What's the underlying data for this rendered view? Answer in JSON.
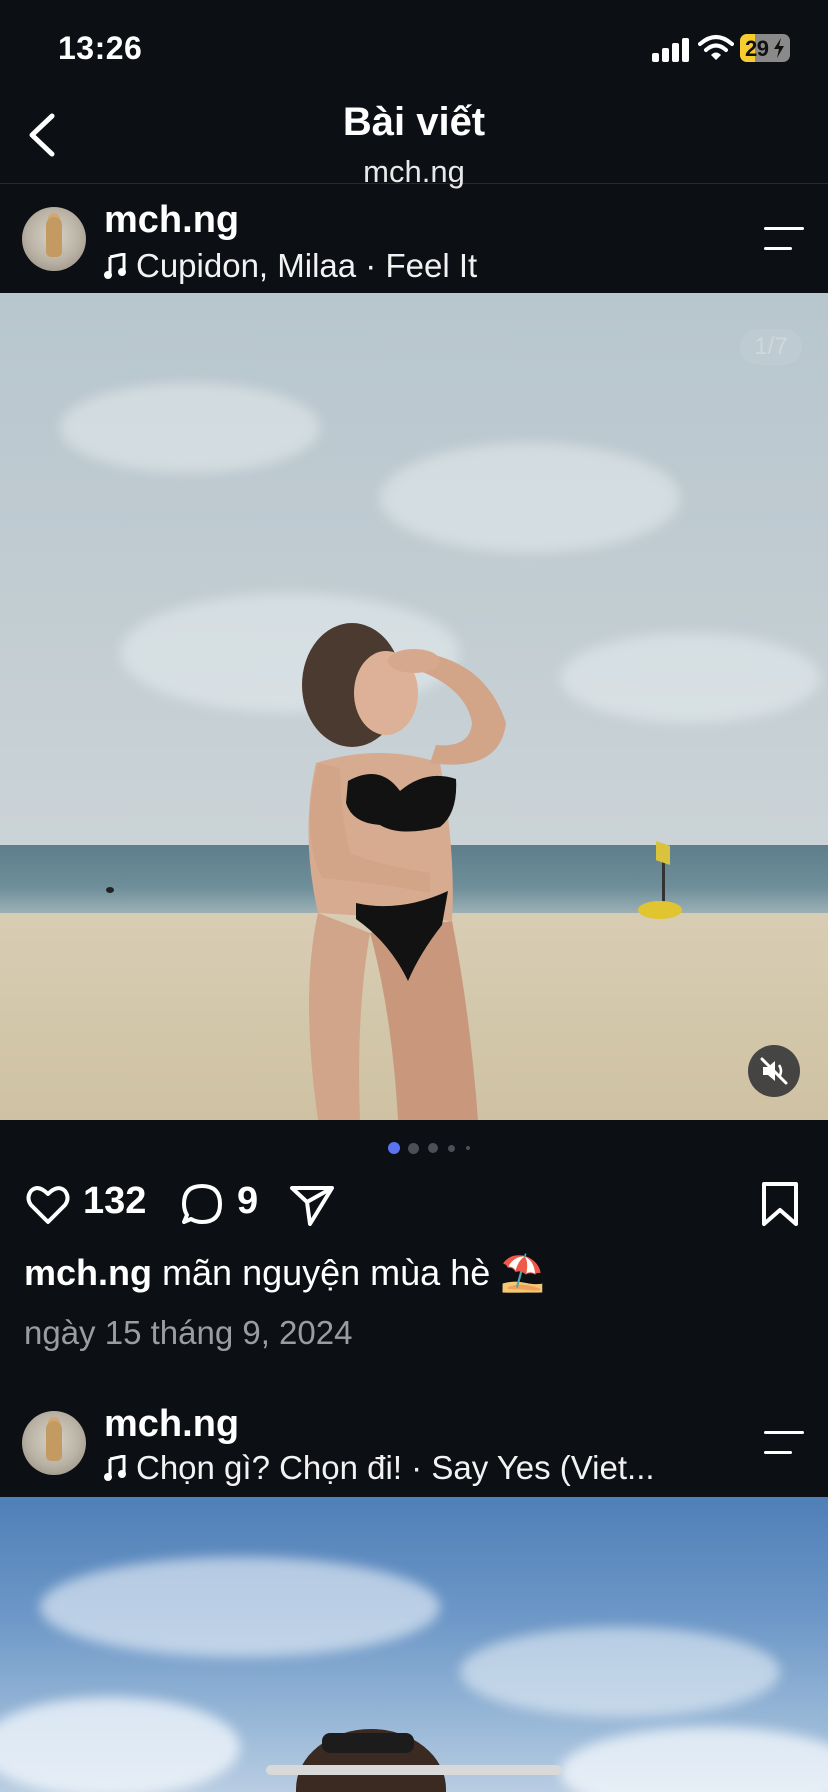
{
  "status_bar": {
    "time": "13:26",
    "battery_level": "29",
    "battery_fraction": 0.29,
    "battery_color": "#f7cc2e",
    "icons": [
      "signal-icon",
      "wifi-icon",
      "battery-icon",
      "charging-bolt-icon"
    ]
  },
  "header": {
    "title": "Bài viết",
    "subtitle": "mch.ng",
    "back_icon": "chevron-left-icon"
  },
  "posts": [
    {
      "username": "mch.ng",
      "music": "Cupidon, Milaa · Feel It",
      "photo_counter": "1/7",
      "likes": "132",
      "comments": "9",
      "caption_user": "mch.ng",
      "caption_text": "mãn nguyện mùa hè ⛱️",
      "date": "ngày 15 tháng 9, 2024",
      "carousel_dots": 5,
      "carousel_active": 0,
      "active_dot_color": "#5b73f0"
    },
    {
      "username": "mch.ng",
      "music": "Chọn gì? Chọn đi! · Say Yes (Viet..."
    }
  ]
}
